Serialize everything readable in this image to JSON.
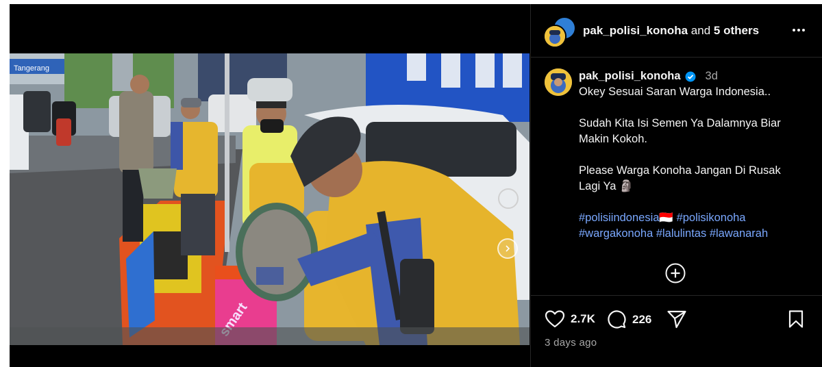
{
  "header": {
    "username": "pak_polisi_konoha",
    "joiner": "and",
    "others": "5 others"
  },
  "caption": {
    "username": "pak_polisi_konoha",
    "time": "3d",
    "lines": [
      "Okey Sesuai Saran Warga Indonesia..",
      "Sudah Kita Isi Semen Ya Dalamnya Biar",
      "Makin Kokoh.",
      "Please Warga Konoha Jangan Di Rusak",
      "Lagi Ya 🗿"
    ],
    "hashtags": {
      "tag1": "#polisiindonesia🇮🇩",
      "tag2": "#polisikonoha",
      "tag3": "#wargakonoha",
      "tag4": "#lalulintas",
      "tag5": "#lawanarah"
    }
  },
  "photo": {
    "signs": [
      "Tangerang",
      "smart"
    ]
  },
  "stats": {
    "likes": "2.7K",
    "comments": "226",
    "posted": "3 days ago"
  },
  "colors": {
    "background": "#000000",
    "link": "#7aa8ff",
    "muted": "#a8a8a8",
    "verified": "#0095f6"
  },
  "icons": [
    "more-icon",
    "verified-icon",
    "add-circle-icon",
    "heart-icon",
    "comment-icon",
    "share-icon",
    "bookmark-icon",
    "user-tag-icon",
    "chevron-right-icon"
  ]
}
